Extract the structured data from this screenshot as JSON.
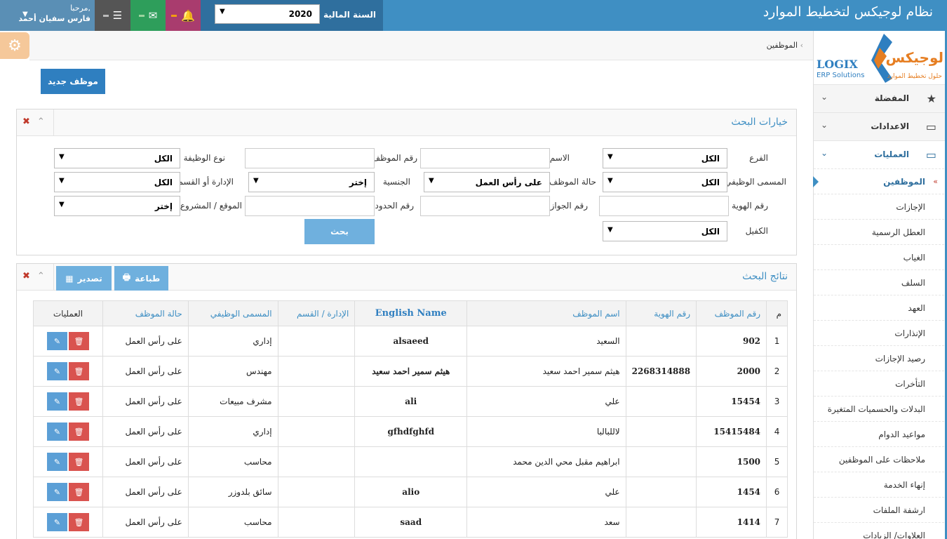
{
  "app": {
    "title": "نظام لوجيكس لتخطيط الموارد"
  },
  "fiscal": {
    "label": "السنة المالية",
    "value": "2020"
  },
  "user": {
    "greeting": "مرحبا,",
    "name": "فارس سفيان أحمد"
  },
  "brand": {
    "name_ar": "لوجيكس",
    "tagline_ar": "حلول تخطيط الموارد",
    "name_en": "LOGIX",
    "sub_en": "ERP Solutions"
  },
  "breadcrumb": {
    "current": "الموظفين"
  },
  "toolbar": {
    "new_label": "موظف جديد"
  },
  "sidebar": {
    "groups": [
      {
        "label": "المفضلة",
        "icon": "star-icon"
      },
      {
        "label": "الاعدادات",
        "icon": "monitor-icon"
      },
      {
        "label": "العمليات",
        "icon": "monitor-icon"
      }
    ],
    "items": [
      {
        "label": "الموظفين"
      },
      {
        "label": "الإجازات"
      },
      {
        "label": "العطل الرسمية"
      },
      {
        "label": "الغياب"
      },
      {
        "label": "السلف"
      },
      {
        "label": "العهد"
      },
      {
        "label": "الإنذارات"
      },
      {
        "label": "رصيد الإجازات"
      },
      {
        "label": "التأخرات"
      },
      {
        "label": "البدلات والحسميات المتغيرة"
      },
      {
        "label": "مواعيد الدوام"
      },
      {
        "label": "ملاحظات على الموظفين"
      },
      {
        "label": "إنهاء الخدمة"
      },
      {
        "label": "ارشفة الملفات"
      },
      {
        "label": "العلاوات/ الزيادات"
      }
    ]
  },
  "search_panel": {
    "title": "خيارات البحث",
    "fields": {
      "branch": {
        "label": "الفرع",
        "value": "الكل"
      },
      "name": {
        "label": "الاسم"
      },
      "emp_no": {
        "label": "رقم الموظف"
      },
      "job_type": {
        "label": "نوع الوظيفة",
        "value": "الكل"
      },
      "job_title": {
        "label": "المسمى الوظيفي",
        "value": "الكل"
      },
      "emp_status": {
        "label": "حالة الموظف",
        "value": "على رأس العمل"
      },
      "nationality": {
        "label": "الجنسية",
        "value": "إختر"
      },
      "department": {
        "label": "الإدارة أو القسم",
        "value": "الكل"
      },
      "id_no": {
        "label": "رقم الهوية"
      },
      "passport": {
        "label": "رقم الجواز"
      },
      "border_no": {
        "label": "رقم الحدود"
      },
      "site": {
        "label": "الموقع / المشروع",
        "value": "إختر"
      },
      "sponsor": {
        "label": "الكفيل",
        "value": "الكل"
      }
    },
    "search_label": "بحث"
  },
  "results_panel": {
    "title": "نتائج البحث",
    "print_label": "طباعة",
    "export_label": "تصدير",
    "columns": [
      "م",
      "رقم الموظف",
      "رقم الهوية",
      "اسم الموظف",
      "English Name",
      "الإدارة / القسم",
      "المسمى الوظيفي",
      "حالة الموظف",
      "العمليات"
    ],
    "rows": [
      {
        "n": "1",
        "emp_no": "902",
        "id_no": "",
        "name": "السعيد",
        "en": "alsaeed",
        "dept": "",
        "title": "إداري",
        "status": "على رأس العمل"
      },
      {
        "n": "2",
        "emp_no": "2000",
        "id_no": "2268314888",
        "name": "هيثم سمير احمد سعيد",
        "en": "هيثم سمير احمد سعيد",
        "dept": "",
        "title": "مهندس",
        "status": "على رأس العمل"
      },
      {
        "n": "3",
        "emp_no": "15454",
        "id_no": "",
        "name": "علي",
        "en": "ali",
        "dept": "",
        "title": "مشرف مبيعات",
        "status": "على رأس العمل"
      },
      {
        "n": "4",
        "emp_no": "15415484",
        "id_no": "",
        "name": "لاللبالبا",
        "en": "gfhdfghfd",
        "dept": "",
        "title": "إداري",
        "status": "على رأس العمل"
      },
      {
        "n": "5",
        "emp_no": "1500",
        "id_no": "",
        "name": "ابراهيم مقبل محي الدين محمد",
        "en": "",
        "dept": "",
        "title": "محاسب",
        "status": "على رأس العمل"
      },
      {
        "n": "6",
        "emp_no": "1454",
        "id_no": "",
        "name": "علي",
        "en": "alio",
        "dept": "",
        "title": "سائق بلدوزر",
        "status": "على رأس العمل"
      },
      {
        "n": "7",
        "emp_no": "1414",
        "id_no": "",
        "name": "سعد",
        "en": "saad",
        "dept": "",
        "title": "محاسب",
        "status": "على رأس العمل"
      }
    ]
  },
  "colors": {
    "primary": "#3f8fc3",
    "header_dark": "#2f6f9e",
    "danger": "#d9534f",
    "btn_light": "#6fb0de"
  }
}
